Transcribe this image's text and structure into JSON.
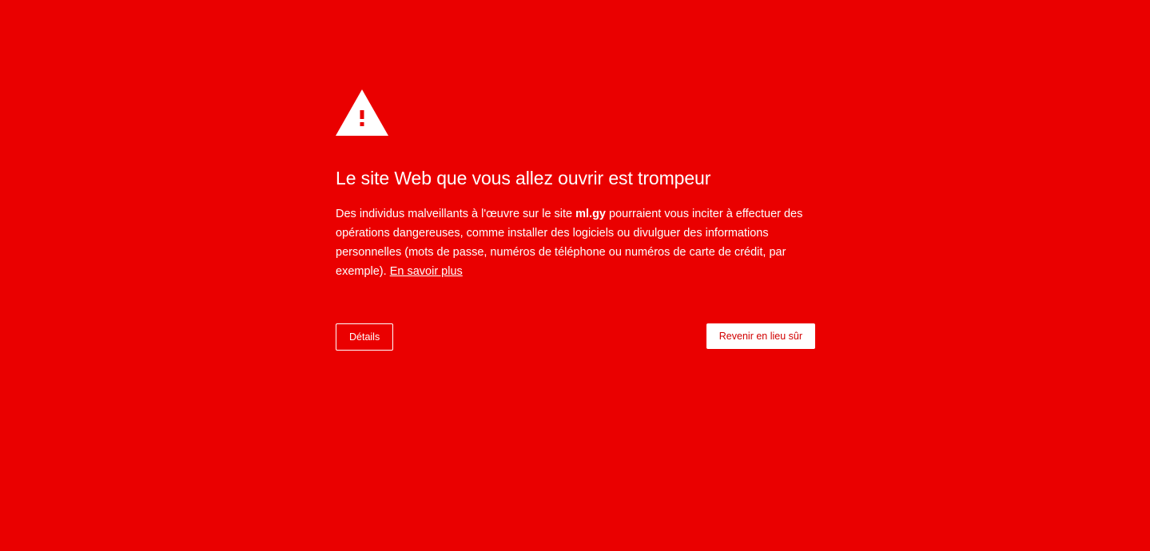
{
  "page": {
    "background_color": "#EA0000"
  },
  "warning_icon": {
    "name": "warning-triangle-icon",
    "color": "#ffffff",
    "mark_color": "#EA0000"
  },
  "heading": "Le site Web que vous allez ouvrir est trompeur",
  "message": {
    "part1": "Des individus malveillants à l'œuvre sur le site ",
    "site": "ml.gy",
    "part2": " pourraient vous inciter à effectuer des opérations dangereuses, comme installer des logiciels ou divulguer des informations personnelles (mots de passe, numéros de téléphone ou numéros de carte de crédit, par exemple). ",
    "learn_more": "En savoir plus"
  },
  "buttons": {
    "details_label": "Détails",
    "back_label": "Revenir en lieu sûr",
    "back_text_color": "#D10000"
  }
}
